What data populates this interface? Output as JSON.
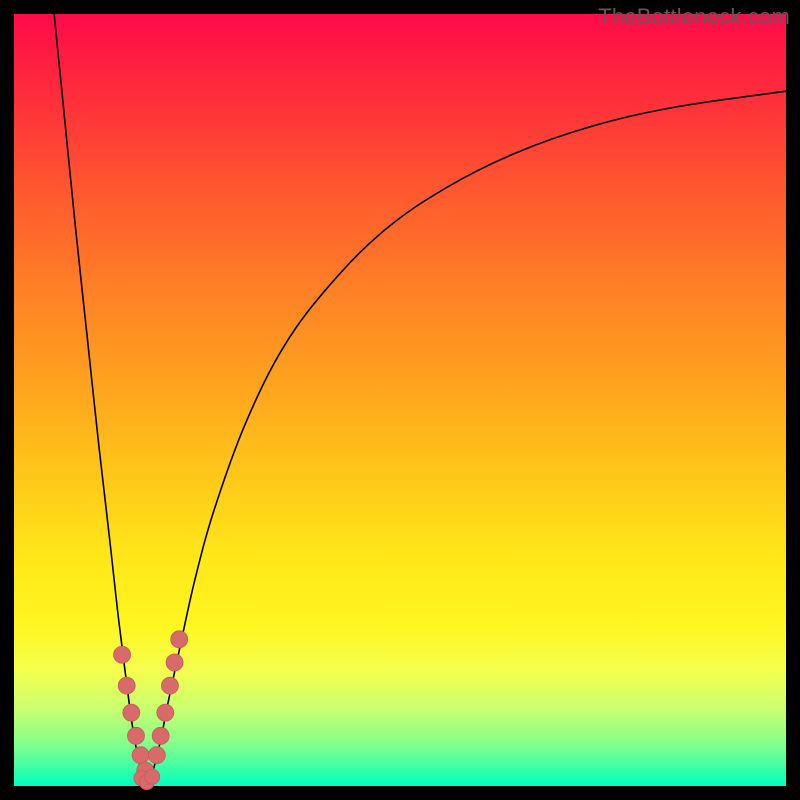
{
  "watermark": "TheBottleneck.com",
  "chart_data": {
    "type": "line",
    "title": "",
    "xlabel": "",
    "ylabel": "",
    "xlim": [
      0,
      100
    ],
    "ylim": [
      0,
      100
    ],
    "grid": false,
    "legend": false,
    "series": [
      {
        "name": "bottleneck-curve-left",
        "x": [
          5.2,
          6.5,
          8.0,
          9.5,
          11.0,
          12.5,
          13.5,
          14.5,
          15.3,
          16.0,
          16.6,
          17.2
        ],
        "values": [
          100,
          87,
          72,
          58,
          44,
          31,
          22,
          14,
          8,
          4,
          1.5,
          0.5
        ]
      },
      {
        "name": "bottleneck-curve-right",
        "x": [
          17.2,
          18.0,
          19.0,
          20.0,
          21.5,
          23.5,
          26.0,
          30.0,
          35.0,
          41.0,
          48.0,
          56.0,
          65.0,
          75.0,
          86.0,
          100.0
        ],
        "values": [
          0.5,
          2,
          6,
          11,
          18,
          27,
          36,
          47,
          57,
          65,
          72,
          77.5,
          82,
          85.5,
          88,
          90
        ]
      }
    ],
    "markers": {
      "name": "highlighted-range",
      "color": "#d86a6a",
      "left_branch": {
        "x": [
          14.0,
          14.6,
          15.2,
          15.8,
          16.4,
          17.0
        ],
        "values": [
          17,
          13,
          9.5,
          6.5,
          4,
          2
        ]
      },
      "right_branch": {
        "x": [
          18.5,
          19.0,
          19.6,
          20.2,
          20.8,
          21.4
        ],
        "values": [
          4,
          6.5,
          9.5,
          13,
          16,
          19
        ]
      },
      "bottom": {
        "x": [
          16.5,
          17.2,
          17.9
        ],
        "values": [
          1,
          0.5,
          1.2
        ]
      }
    },
    "background_gradient": {
      "direction": "vertical",
      "stops": [
        {
          "pos": 0.0,
          "color": "#ff0a4a"
        },
        {
          "pos": 0.35,
          "color": "#ff7e26"
        },
        {
          "pos": 0.7,
          "color": "#ffe619"
        },
        {
          "pos": 0.92,
          "color": "#8cff87"
        },
        {
          "pos": 1.0,
          "color": "#00ffc3"
        }
      ]
    }
  }
}
